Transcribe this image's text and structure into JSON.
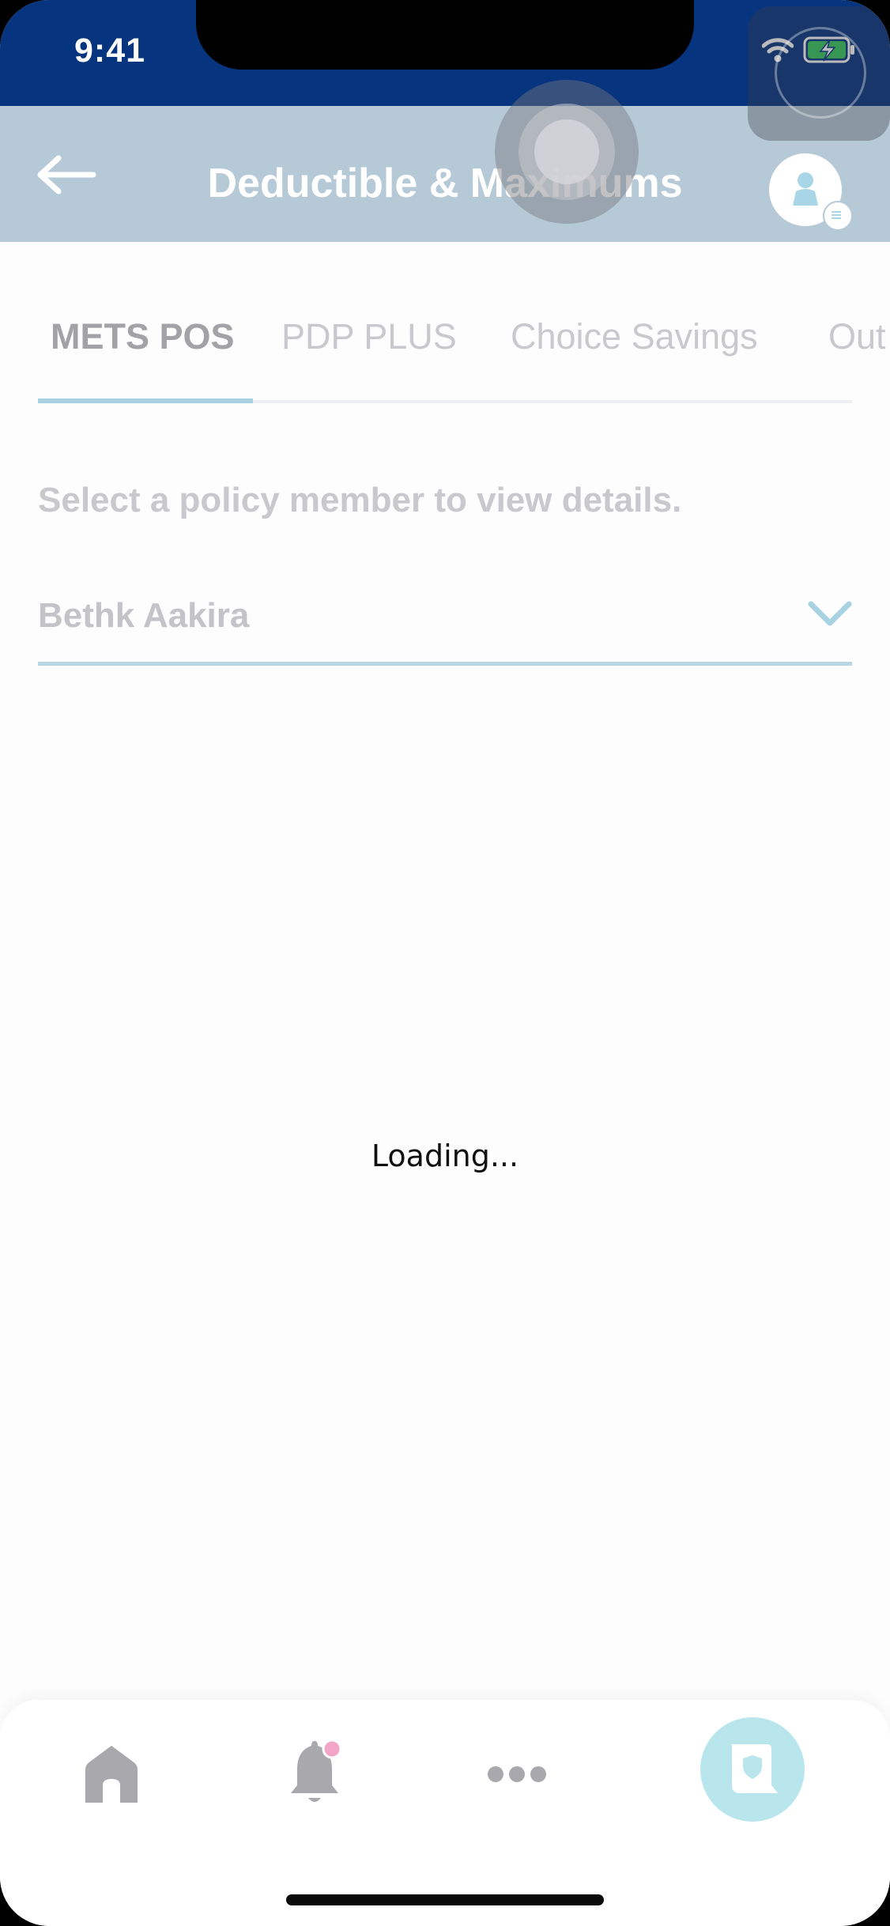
{
  "status_bar": {
    "time": "9:41",
    "icons": [
      "wifi-icon",
      "battery-charging-icon"
    ]
  },
  "header": {
    "title": "Deductible & Maximums",
    "back_icon": "arrow-left-icon",
    "avatar_icon": "user-avatar-icon"
  },
  "tabs": [
    {
      "label": "METS POS",
      "active": true
    },
    {
      "label": "PDP PLUS",
      "active": false
    },
    {
      "label": "Choice Savings",
      "active": false
    },
    {
      "label": "Out",
      "active": false
    }
  ],
  "member_selector": {
    "instruction": "Select a policy member to view details.",
    "selected": "Bethk Aakira",
    "icon": "chevron-down-icon"
  },
  "main": {
    "loading_text": "Loading..."
  },
  "bottom_nav": {
    "items": [
      {
        "icon": "home-icon"
      },
      {
        "icon": "bell-icon",
        "badge": true
      },
      {
        "icon": "more-icon"
      },
      {
        "icon": "policy-document-icon",
        "active": true
      }
    ]
  },
  "colors": {
    "status_bar": "#06347f",
    "header": "#b6c9d7",
    "tab_indicator": "#a7d2e1",
    "active_nav": "#b9e5ec",
    "notification_badge": "#f3a5c8"
  }
}
